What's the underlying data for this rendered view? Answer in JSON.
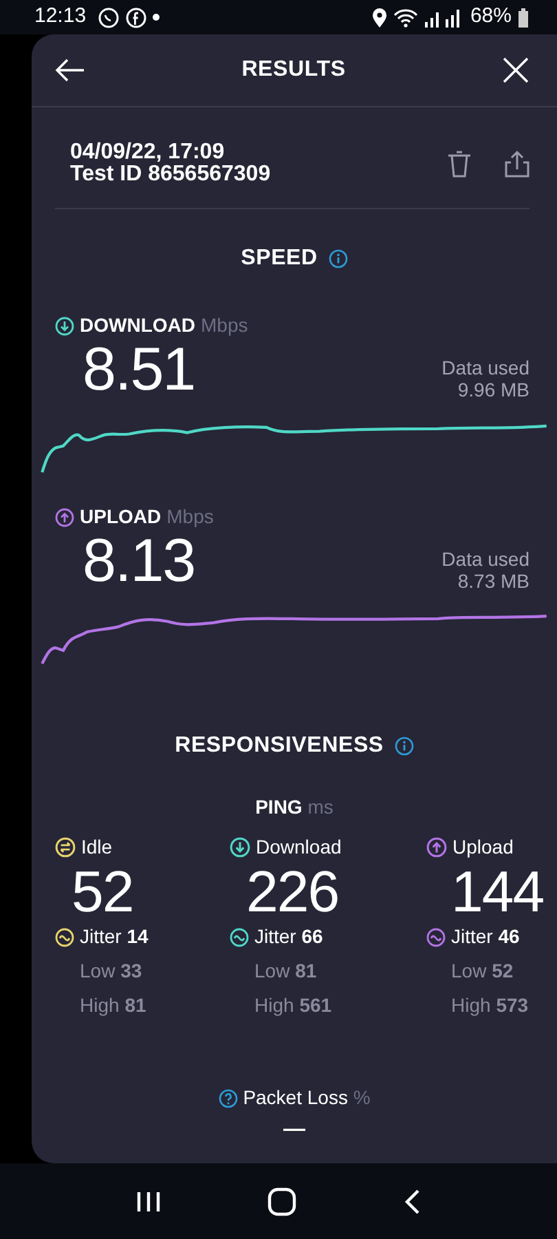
{
  "status_bar": {
    "time": "12:13",
    "battery": "68%"
  },
  "header": {
    "title": "RESULTS"
  },
  "test": {
    "date": "04/09/22, 17:09",
    "test_id": "Test ID 8656567309"
  },
  "speed": {
    "title": "SPEED",
    "metrics": [
      {
        "kind": "download",
        "label": "DOWNLOAD",
        "unit": "Mbps",
        "value": "8.51",
        "data_used_label": "Data used",
        "data_used": "9.96 MB",
        "color": "#4fd8c6"
      },
      {
        "kind": "upload",
        "label": "UPLOAD",
        "unit": "Mbps",
        "value": "8.13",
        "data_used_label": "Data used",
        "data_used": "8.73 MB",
        "color": "#b374e6"
      }
    ]
  },
  "responsiveness": {
    "title": "RESPONSIVENESS",
    "ping_label": "PING",
    "ping_unit": "ms",
    "columns": [
      {
        "kind": "idle",
        "label": "Idle",
        "color": "#e8d36e",
        "value": "52",
        "jitter_label": "Jitter",
        "jitter": "14",
        "low_label": "Low",
        "low": "33",
        "high_label": "High",
        "high": "81"
      },
      {
        "kind": "download",
        "label": "Download",
        "color": "#4fd8c6",
        "value": "226",
        "jitter_label": "Jitter",
        "jitter": "66",
        "low_label": "Low",
        "low": "81",
        "high_label": "High",
        "high": "561"
      },
      {
        "kind": "upload",
        "label": "Upload",
        "color": "#b374e6",
        "value": "144",
        "jitter_label": "Jitter",
        "jitter": "46",
        "low_label": "Low",
        "low": "52",
        "high_label": "High",
        "high": "573"
      }
    ]
  },
  "packet_loss": {
    "label": "Packet Loss",
    "unit": "%",
    "value": "—"
  }
}
